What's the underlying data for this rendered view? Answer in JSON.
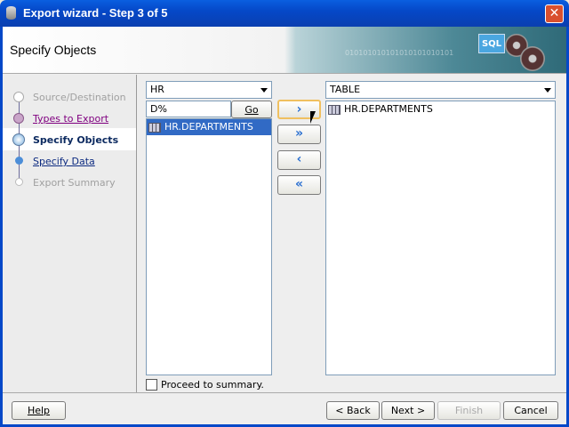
{
  "window": {
    "title": "Export wizard - Step 3 of 5",
    "close": "✕"
  },
  "header": {
    "title": "Specify Objects",
    "banner_text": "010101010101010101010101",
    "logo_text": "SQL"
  },
  "nav": {
    "steps": [
      {
        "label": "Source/Destination",
        "state": "done-disabled"
      },
      {
        "label": "Types to Export",
        "state": "visited"
      },
      {
        "label": "Specify Objects",
        "state": "current"
      },
      {
        "label": "Specify Data",
        "state": "link"
      },
      {
        "label": "Export Summary",
        "state": "disabled"
      }
    ]
  },
  "left": {
    "schema": "HR",
    "filter": "D%",
    "go": "Go",
    "items": [
      "HR.DEPARTMENTS"
    ]
  },
  "right": {
    "type": "TABLE",
    "items": [
      "HR.DEPARTMENTS"
    ]
  },
  "move": {
    "add": "›",
    "add_all": "»",
    "remove": "‹",
    "remove_all": "«"
  },
  "proceed": {
    "label": "Proceed to summary.",
    "checked": false
  },
  "buttons": {
    "help": "Help",
    "back": "< Back",
    "next": "Next >",
    "finish": "Finish",
    "cancel": "Cancel"
  }
}
